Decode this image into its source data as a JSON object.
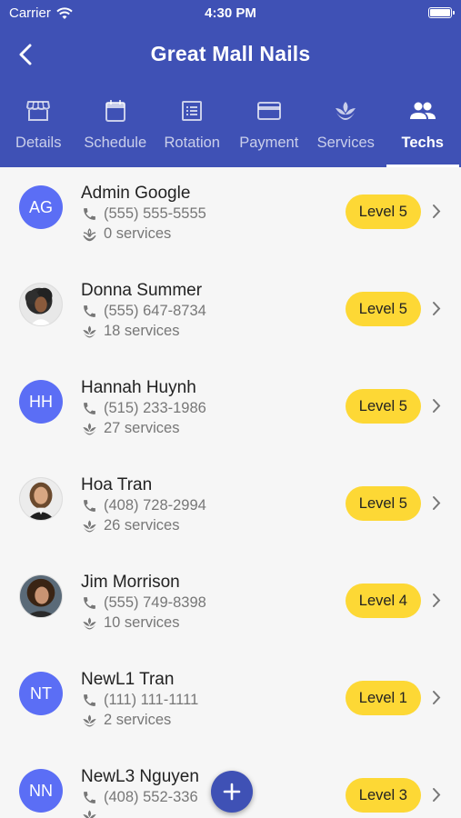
{
  "status_bar": {
    "carrier": "Carrier",
    "time": "4:30 PM"
  },
  "nav": {
    "title": "Great Mall Nails"
  },
  "tabs": [
    {
      "label": "Details",
      "icon": "store-icon"
    },
    {
      "label": "Schedule",
      "icon": "calendar-icon"
    },
    {
      "label": "Rotation",
      "icon": "list-icon"
    },
    {
      "label": "Payment",
      "icon": "card-icon"
    },
    {
      "label": "Services",
      "icon": "spa-icon"
    },
    {
      "label": "Techs",
      "icon": "people-icon",
      "active": true
    }
  ],
  "techs": [
    {
      "initials": "AG",
      "name": "Admin Google",
      "phone": "(555) 555-5555",
      "services": "0 services",
      "level": "Level 5"
    },
    {
      "initials": "",
      "name": "Donna Summer",
      "phone": "(555) 647-8734",
      "services": "18 services",
      "level": "Level 5"
    },
    {
      "initials": "HH",
      "name": "Hannah Huynh",
      "phone": "(515) 233-1986",
      "services": "27 services",
      "level": "Level 5"
    },
    {
      "initials": "",
      "name": "Hoa Tran",
      "phone": "(408) 728-2994",
      "services": "26 services",
      "level": "Level 5"
    },
    {
      "initials": "",
      "name": "Jim Morrison",
      "phone": "(555) 749-8398",
      "services": "10 services",
      "level": "Level 4"
    },
    {
      "initials": "NT",
      "name": "NewL1 Tran",
      "phone": "(111) 111-1111",
      "services": "2 services",
      "level": "Level 1"
    },
    {
      "initials": "NN",
      "name": "NewL3 Nguyen",
      "phone": "(408) 552-336",
      "services": "",
      "level": "Level 3"
    }
  ],
  "colors": {
    "primary": "#3f51b5",
    "avatar": "#5b6ef5",
    "badge": "#fdd835"
  }
}
